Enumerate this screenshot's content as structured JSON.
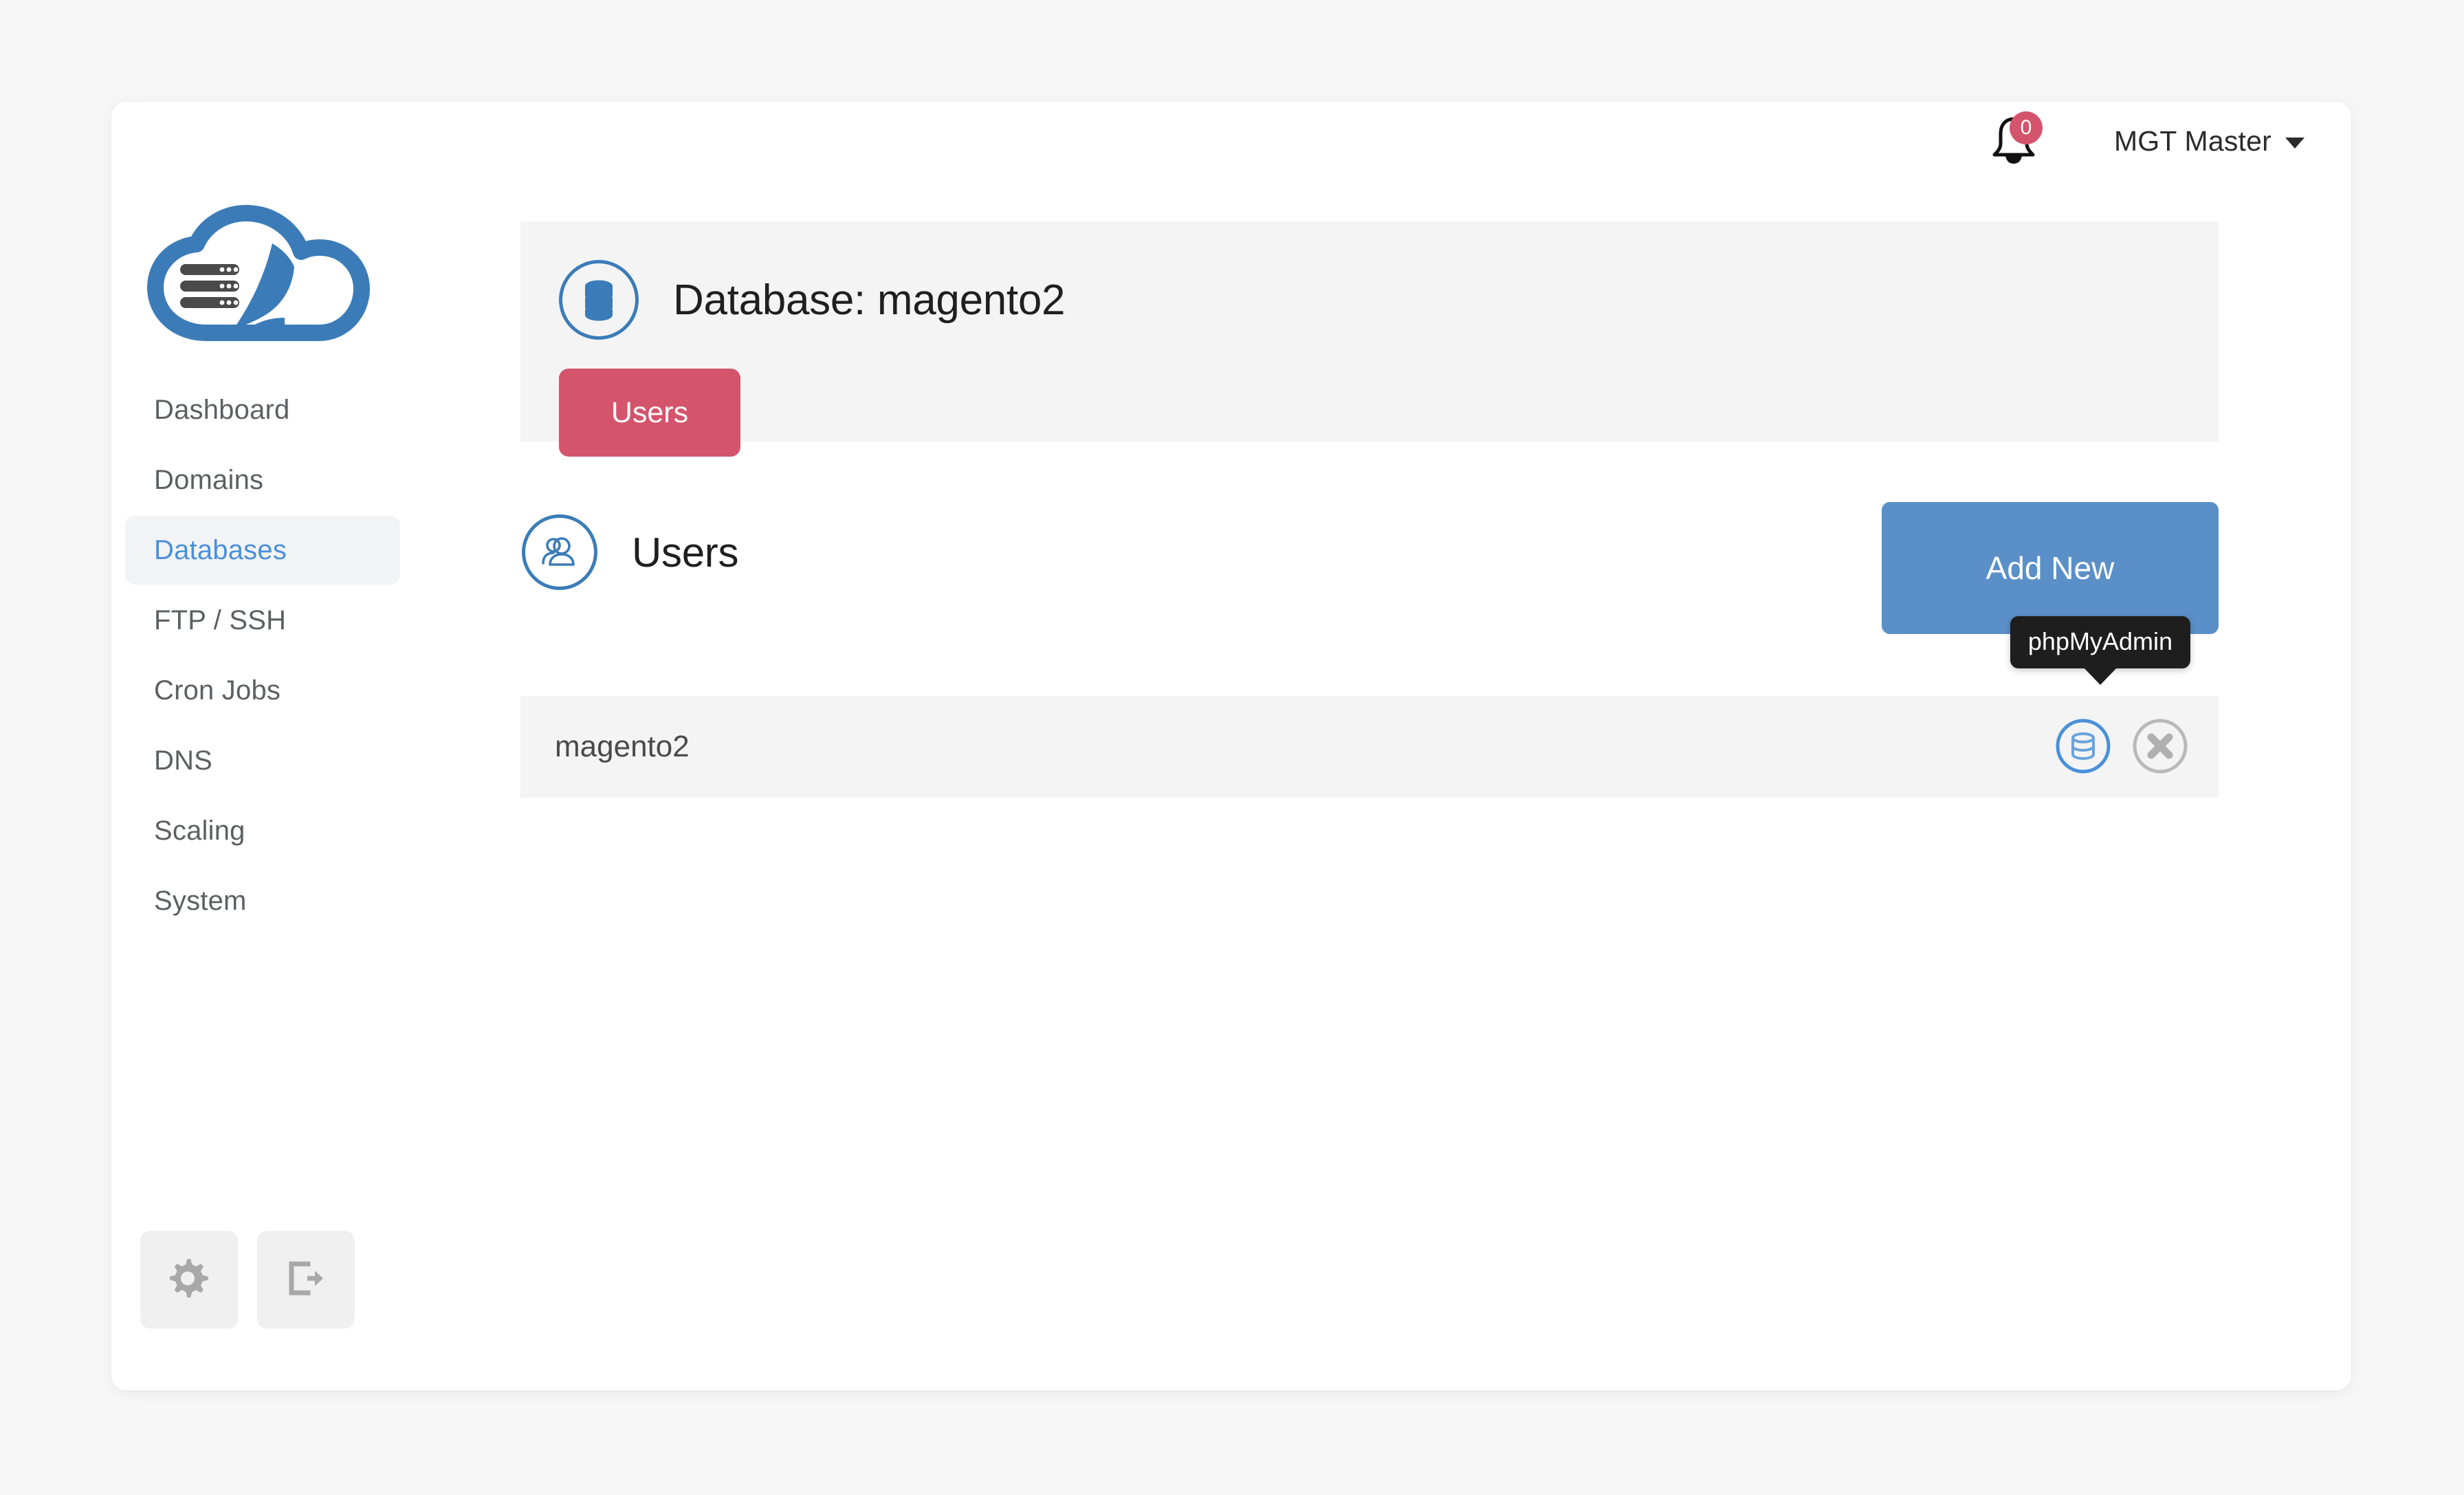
{
  "header": {
    "notifications": {
      "icon": "bell-icon",
      "count": "0",
      "badge_color": "#d4546b"
    },
    "user_menu": {
      "label": "MGT Master",
      "caret_icon": "chevron-down-icon"
    }
  },
  "sidebar": {
    "logo": {
      "icon": "cloud-server-logo",
      "color": "#3b7cb8"
    },
    "items": [
      {
        "label": "Dashboard",
        "active": false
      },
      {
        "label": "Domains",
        "active": false
      },
      {
        "label": "Databases",
        "active": true
      },
      {
        "label": "FTP / SSH",
        "active": false
      },
      {
        "label": "Cron Jobs",
        "active": false
      },
      {
        "label": "DNS",
        "active": false
      },
      {
        "label": "Scaling",
        "active": false
      },
      {
        "label": "System",
        "active": false
      }
    ],
    "active_color": "#4a90d9",
    "footer_buttons": [
      {
        "icon": "gear-icon",
        "name": "settings-button"
      },
      {
        "icon": "logout-icon",
        "name": "logout-button"
      }
    ]
  },
  "database_panel": {
    "icon": "database-icon",
    "title": "Database: magento2",
    "tabs": [
      {
        "label": "Users",
        "active": true,
        "color": "#d4546b"
      }
    ]
  },
  "users_section": {
    "icon": "users-icon",
    "title": "Users",
    "add_button": {
      "label": "Add New",
      "color": "#5b8fc7"
    },
    "tooltip": {
      "text": "phpMyAdmin"
    },
    "rows": [
      {
        "name": "magento2",
        "actions": [
          {
            "icon": "database-icon",
            "name": "phpmyadmin-button"
          },
          {
            "icon": "close-circle-icon",
            "name": "delete-button"
          }
        ]
      }
    ]
  }
}
